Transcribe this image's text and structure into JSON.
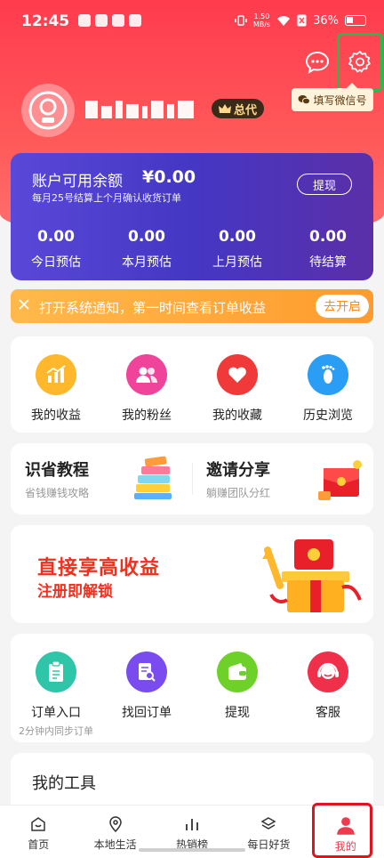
{
  "status_bar": {
    "time": "12:45",
    "speed": "1.50",
    "speed_unit": "MB/s",
    "battery": "36%"
  },
  "header": {
    "wechat_tip": "填写微信号",
    "vip_badge": "总代"
  },
  "balance": {
    "title": "账户可用余额",
    "amount": "¥0.00",
    "subtitle": "每月25号结算上个月确认收货订单",
    "withdraw_label": "提现",
    "stats": [
      {
        "value": "0.00",
        "label": "今日预估"
      },
      {
        "value": "0.00",
        "label": "本月预估"
      },
      {
        "value": "0.00",
        "label": "上月预估"
      },
      {
        "value": "0.00",
        "label": "待结算"
      }
    ]
  },
  "notify": {
    "message": "打开系统通知，第一时间查看订单收益",
    "action": "去开启"
  },
  "quick_menu": [
    {
      "label": "我的收益",
      "color": "#ffb72b"
    },
    {
      "label": "我的粉丝",
      "color": "#f0449a"
    },
    {
      "label": "我的收藏",
      "color": "#f03a3a"
    },
    {
      "label": "历史浏览",
      "color": "#2a9df4"
    }
  ],
  "promos": [
    {
      "title": "识省教程",
      "subtitle": "省钱赚钱攻略"
    },
    {
      "title": "邀请分享",
      "subtitle": "躺赚团队分红"
    }
  ],
  "banner": {
    "line1": "直接享高收益",
    "line2": "注册即解锁"
  },
  "order_menu": [
    {
      "label": "订单入口",
      "sub": "2分钟内同步订单",
      "color": "#2ec5a8"
    },
    {
      "label": "找回订单",
      "sub": "",
      "color": "#7a4cf0"
    },
    {
      "label": "提现",
      "sub": "",
      "color": "#6ed12a"
    },
    {
      "label": "客服",
      "sub": "",
      "color": "#f0304a"
    }
  ],
  "tools": {
    "title": "我的工具"
  },
  "bottom_nav": [
    {
      "label": "首页"
    },
    {
      "label": "本地生活"
    },
    {
      "label": "热销榜"
    },
    {
      "label": "每日好货"
    },
    {
      "label": "我的"
    }
  ]
}
